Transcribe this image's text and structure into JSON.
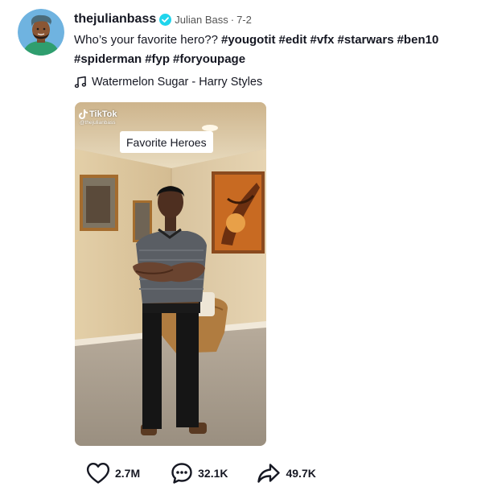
{
  "post": {
    "username": "thejulianbass",
    "nickname": "Julian Bass",
    "separator": "·",
    "date": "7-2",
    "caption": "Who’s your favorite hero??",
    "hashtags": [
      "#yougotit",
      "#edit",
      "#vfx",
      "#starwars",
      "#ben10",
      "#spiderman",
      "#fyp",
      "#foryoupage"
    ],
    "music": "Watermelon Sugar - Harry Styles"
  },
  "video": {
    "watermark_brand": "TikTok",
    "watermark_handle": "@thejulianbass",
    "overlay_label": "Favorite Heroes"
  },
  "actions": {
    "likes": "2.7M",
    "comments": "32.1K",
    "shares": "49.7K"
  },
  "colors": {
    "text": "#161823",
    "verified": "#20d5ec",
    "subtext": "#555555"
  },
  "icons": {
    "verified": "verified-badge-icon",
    "music": "music-note-icon",
    "like": "heart-icon",
    "comment": "comment-icon",
    "share": "share-icon",
    "tiktok": "tiktok-logo-icon"
  }
}
